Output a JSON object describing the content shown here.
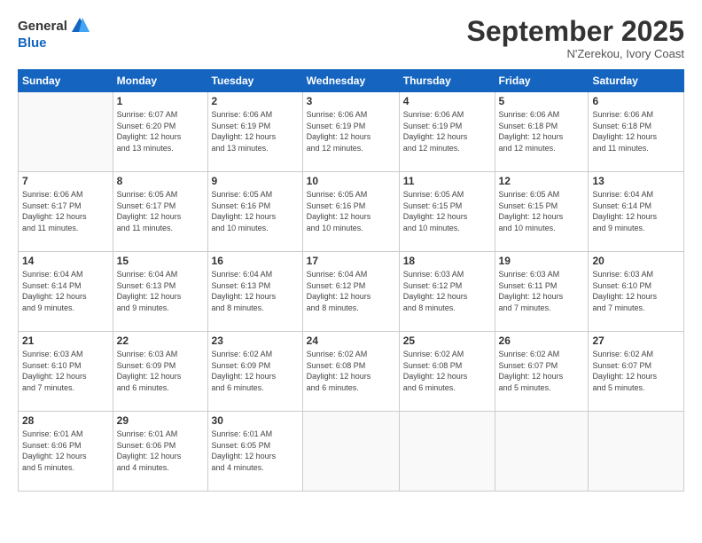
{
  "logo": {
    "general": "General",
    "blue": "Blue"
  },
  "title": "September 2025",
  "subtitle": "N'Zerekou, Ivory Coast",
  "headers": [
    "Sunday",
    "Monday",
    "Tuesday",
    "Wednesday",
    "Thursday",
    "Friday",
    "Saturday"
  ],
  "weeks": [
    [
      {
        "num": "",
        "info": ""
      },
      {
        "num": "1",
        "info": "Sunrise: 6:07 AM\nSunset: 6:20 PM\nDaylight: 12 hours\nand 13 minutes."
      },
      {
        "num": "2",
        "info": "Sunrise: 6:06 AM\nSunset: 6:19 PM\nDaylight: 12 hours\nand 13 minutes."
      },
      {
        "num": "3",
        "info": "Sunrise: 6:06 AM\nSunset: 6:19 PM\nDaylight: 12 hours\nand 12 minutes."
      },
      {
        "num": "4",
        "info": "Sunrise: 6:06 AM\nSunset: 6:19 PM\nDaylight: 12 hours\nand 12 minutes."
      },
      {
        "num": "5",
        "info": "Sunrise: 6:06 AM\nSunset: 6:18 PM\nDaylight: 12 hours\nand 12 minutes."
      },
      {
        "num": "6",
        "info": "Sunrise: 6:06 AM\nSunset: 6:18 PM\nDaylight: 12 hours\nand 11 minutes."
      }
    ],
    [
      {
        "num": "7",
        "info": "Sunrise: 6:06 AM\nSunset: 6:17 PM\nDaylight: 12 hours\nand 11 minutes."
      },
      {
        "num": "8",
        "info": "Sunrise: 6:05 AM\nSunset: 6:17 PM\nDaylight: 12 hours\nand 11 minutes."
      },
      {
        "num": "9",
        "info": "Sunrise: 6:05 AM\nSunset: 6:16 PM\nDaylight: 12 hours\nand 10 minutes."
      },
      {
        "num": "10",
        "info": "Sunrise: 6:05 AM\nSunset: 6:16 PM\nDaylight: 12 hours\nand 10 minutes."
      },
      {
        "num": "11",
        "info": "Sunrise: 6:05 AM\nSunset: 6:15 PM\nDaylight: 12 hours\nand 10 minutes."
      },
      {
        "num": "12",
        "info": "Sunrise: 6:05 AM\nSunset: 6:15 PM\nDaylight: 12 hours\nand 10 minutes."
      },
      {
        "num": "13",
        "info": "Sunrise: 6:04 AM\nSunset: 6:14 PM\nDaylight: 12 hours\nand 9 minutes."
      }
    ],
    [
      {
        "num": "14",
        "info": "Sunrise: 6:04 AM\nSunset: 6:14 PM\nDaylight: 12 hours\nand 9 minutes."
      },
      {
        "num": "15",
        "info": "Sunrise: 6:04 AM\nSunset: 6:13 PM\nDaylight: 12 hours\nand 9 minutes."
      },
      {
        "num": "16",
        "info": "Sunrise: 6:04 AM\nSunset: 6:13 PM\nDaylight: 12 hours\nand 8 minutes."
      },
      {
        "num": "17",
        "info": "Sunrise: 6:04 AM\nSunset: 6:12 PM\nDaylight: 12 hours\nand 8 minutes."
      },
      {
        "num": "18",
        "info": "Sunrise: 6:03 AM\nSunset: 6:12 PM\nDaylight: 12 hours\nand 8 minutes."
      },
      {
        "num": "19",
        "info": "Sunrise: 6:03 AM\nSunset: 6:11 PM\nDaylight: 12 hours\nand 7 minutes."
      },
      {
        "num": "20",
        "info": "Sunrise: 6:03 AM\nSunset: 6:10 PM\nDaylight: 12 hours\nand 7 minutes."
      }
    ],
    [
      {
        "num": "21",
        "info": "Sunrise: 6:03 AM\nSunset: 6:10 PM\nDaylight: 12 hours\nand 7 minutes."
      },
      {
        "num": "22",
        "info": "Sunrise: 6:03 AM\nSunset: 6:09 PM\nDaylight: 12 hours\nand 6 minutes."
      },
      {
        "num": "23",
        "info": "Sunrise: 6:02 AM\nSunset: 6:09 PM\nDaylight: 12 hours\nand 6 minutes."
      },
      {
        "num": "24",
        "info": "Sunrise: 6:02 AM\nSunset: 6:08 PM\nDaylight: 12 hours\nand 6 minutes."
      },
      {
        "num": "25",
        "info": "Sunrise: 6:02 AM\nSunset: 6:08 PM\nDaylight: 12 hours\nand 6 minutes."
      },
      {
        "num": "26",
        "info": "Sunrise: 6:02 AM\nSunset: 6:07 PM\nDaylight: 12 hours\nand 5 minutes."
      },
      {
        "num": "27",
        "info": "Sunrise: 6:02 AM\nSunset: 6:07 PM\nDaylight: 12 hours\nand 5 minutes."
      }
    ],
    [
      {
        "num": "28",
        "info": "Sunrise: 6:01 AM\nSunset: 6:06 PM\nDaylight: 12 hours\nand 5 minutes."
      },
      {
        "num": "29",
        "info": "Sunrise: 6:01 AM\nSunset: 6:06 PM\nDaylight: 12 hours\nand 4 minutes."
      },
      {
        "num": "30",
        "info": "Sunrise: 6:01 AM\nSunset: 6:05 PM\nDaylight: 12 hours\nand 4 minutes."
      },
      {
        "num": "",
        "info": ""
      },
      {
        "num": "",
        "info": ""
      },
      {
        "num": "",
        "info": ""
      },
      {
        "num": "",
        "info": ""
      }
    ]
  ]
}
